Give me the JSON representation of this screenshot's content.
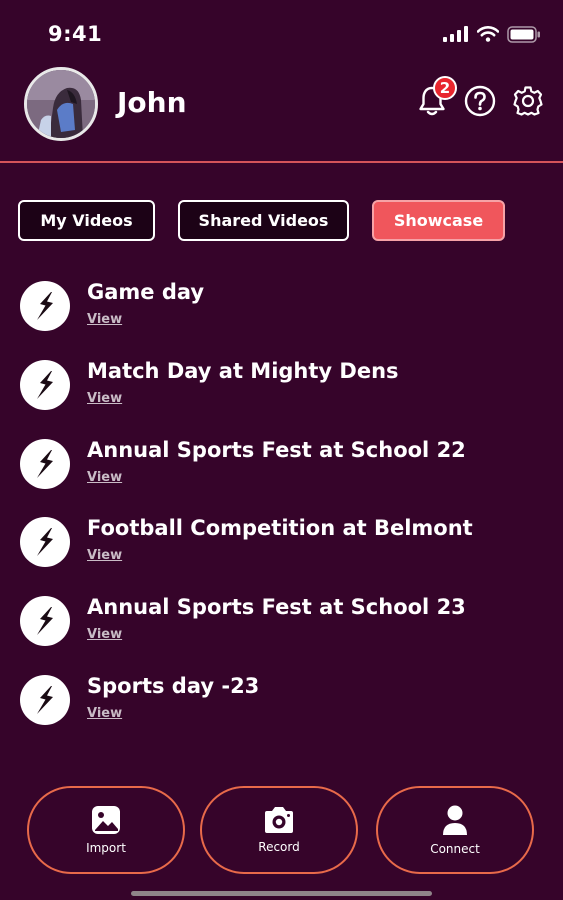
{
  "status_bar": {
    "time": "9:41"
  },
  "header": {
    "user_name": "John",
    "notification_count": "2"
  },
  "tabs": [
    {
      "label": "My Videos",
      "active": false
    },
    {
      "label": "Shared Videos",
      "active": false
    },
    {
      "label": "Showcase",
      "active": true
    }
  ],
  "videos": [
    {
      "title": "Game day",
      "link": "View"
    },
    {
      "title": "Match Day at Mighty Dens",
      "link": "View"
    },
    {
      "title": "Annual Sports Fest at School 22",
      "link": "View"
    },
    {
      "title": "Football Competition at Belmont",
      "link": "View"
    },
    {
      "title": "Annual Sports Fest at School 23",
      "link": "View"
    },
    {
      "title": "Sports day -23",
      "link": "View"
    }
  ],
  "bottom_actions": [
    {
      "label": "Import",
      "icon": "image-icon"
    },
    {
      "label": "Record",
      "icon": "camera-icon"
    },
    {
      "label": "Connect",
      "icon": "person-icon"
    }
  ],
  "colors": {
    "background": "#36042a",
    "accent": "#f0565c",
    "badge": "#e8262e",
    "divider": "#d4545a",
    "action_border": "#e86a4a"
  }
}
